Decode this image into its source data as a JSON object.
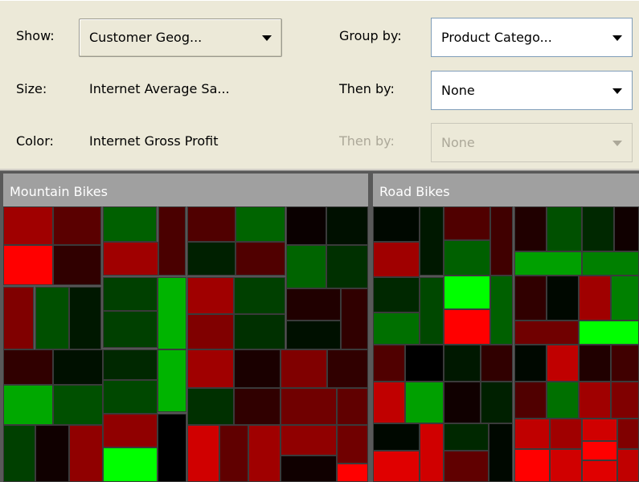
{
  "controls": {
    "show_label": "Show:",
    "show_value": "Customer Geog...",
    "size_label": "Size:",
    "size_value": "Internet Average Sa...",
    "color_label": "Color:",
    "color_value": "Internet Gross Profit",
    "group_by_label": "Group by:",
    "group_by_value": "Product Catego...",
    "then_by_label": "Then by:",
    "then_by_value": "None",
    "then_by2_label": "Then by:",
    "then_by2_value": "None"
  },
  "treemap": {
    "groups": [
      {
        "label": "Mountain Bikes"
      },
      {
        "label": "Road Bikes"
      }
    ]
  }
}
